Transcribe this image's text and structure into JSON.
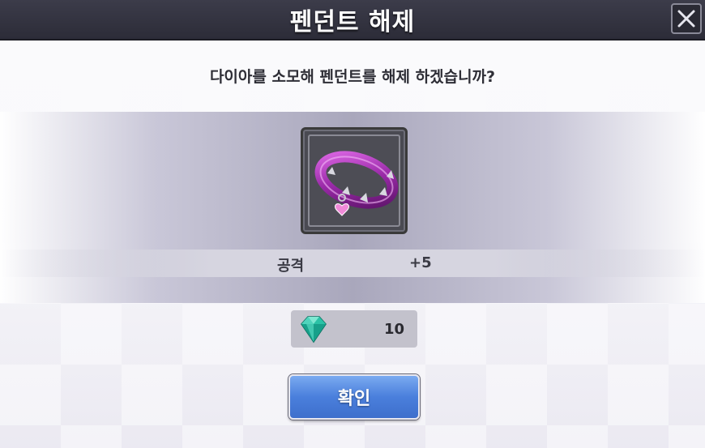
{
  "dialog": {
    "title": "펜던트 해제",
    "close_icon": "close-icon",
    "question": "다이아를 소모해 펜던트를 해제 하겠습니까?"
  },
  "item": {
    "icon": "pendant-ring-icon",
    "stat_label": "공격",
    "stat_value": "+5"
  },
  "cost": {
    "currency_icon": "diamond-gem-icon",
    "amount": "10"
  },
  "confirm": {
    "label": "확인",
    "color": "#4a7fdc"
  }
}
